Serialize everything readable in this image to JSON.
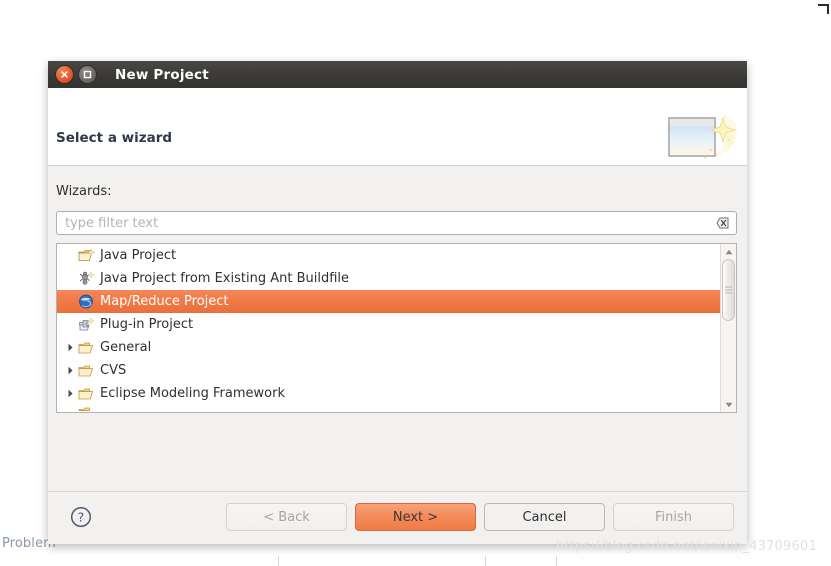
{
  "window": {
    "title": "New Project",
    "close_icon": "close-icon",
    "maximize_icon": "maximize-icon"
  },
  "header": {
    "title": "Select a wizard",
    "banner_icon": "wizard-sparkle-icon"
  },
  "body": {
    "wizards_label": "Wizards:",
    "filter": {
      "value": "",
      "placeholder": "type filter text",
      "clear_icon": "clear-filter-icon"
    },
    "list": [
      {
        "label": "Java Project",
        "icon": "java-project-icon",
        "type": "leaf",
        "selected": false
      },
      {
        "label": "Java Project from Existing Ant Buildfile",
        "icon": "ant-buildfile-icon",
        "type": "leaf",
        "selected": false
      },
      {
        "label": "Map/Reduce Project",
        "icon": "map-reduce-icon",
        "type": "leaf",
        "selected": true
      },
      {
        "label": "Plug-in Project",
        "icon": "plugin-project-icon",
        "type": "leaf",
        "selected": false
      },
      {
        "label": "General",
        "icon": "folder-icon",
        "type": "category",
        "selected": false
      },
      {
        "label": "CVS",
        "icon": "folder-icon",
        "type": "category",
        "selected": false
      },
      {
        "label": "Eclipse Modeling Framework",
        "icon": "folder-icon",
        "type": "category",
        "selected": false
      }
    ],
    "scrollbar": {
      "up_icon": "scroll-up-icon",
      "down_icon": "scroll-down-icon",
      "thumb_icon": "scroll-thumb-grip"
    }
  },
  "footer": {
    "help_icon": "help-icon",
    "buttons": [
      {
        "label": "< Back",
        "state": "disabled"
      },
      {
        "label": "Next >",
        "state": "primary"
      },
      {
        "label": "Cancel",
        "state": "normal"
      },
      {
        "label": "Finish",
        "state": "disabled"
      }
    ]
  },
  "background": {
    "problems_tab": "Problem",
    "watermark": "https://blog.csdn.net/weixin_43709601"
  },
  "colors": {
    "selection": "#ef7b45",
    "titlebar": "#3b3a36",
    "dialog_bg": "#f2f1f0",
    "close_button": "#e2572a"
  }
}
